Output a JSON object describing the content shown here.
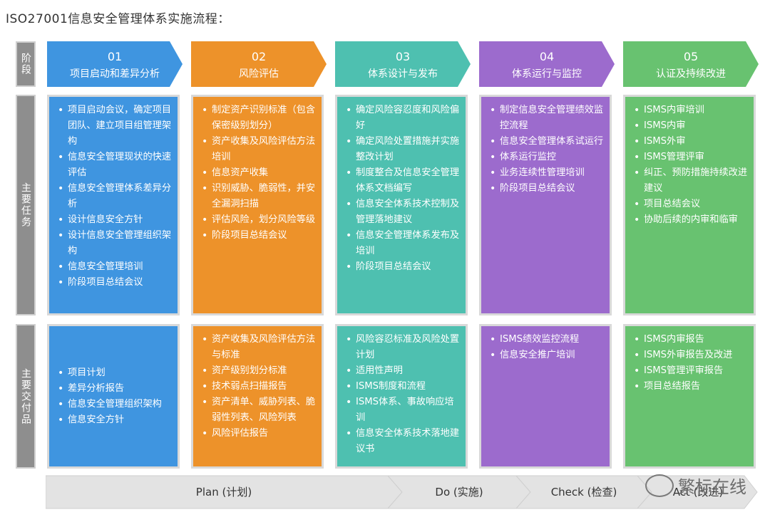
{
  "title": "ISO27001信息安全管理体系实施流程：",
  "row_labels": {
    "stage": "阶段",
    "tasks": "主要任务",
    "deliverables": "主要交付品"
  },
  "phases": [
    {
      "num": "01",
      "name": "项目启动和差异分析",
      "color": "#3f95e0",
      "tasks": [
        "项目启动会议，确定项目团队、建立项目组管理架构",
        "信息安全管理现状的快速评估",
        "信息安全管理体系差异分析",
        "设计信息安全方针",
        "设计信息安全管理组织架构",
        "信息安全管理培训",
        "阶段项目总结会议"
      ],
      "deliverables": [
        "项目计划",
        "差异分析报告",
        "信息安全管理组织架构",
        "信息安全方针"
      ]
    },
    {
      "num": "02",
      "name": "风险评估",
      "color": "#ed922a",
      "tasks": [
        "制定资产识别标准（包含保密级别划分）",
        "资产收集及风险评估方法培训",
        "信息资产收集",
        "识别威胁、脆弱性，并安全漏洞扫描",
        "评估风险，划分风险等级",
        "阶段项目总结会议"
      ],
      "deliverables": [
        "资产收集及风险评估方法与标准",
        "资产级别划分标准",
        "技术弱点扫描报告",
        "资产清单、威胁列表、脆弱性列表、风险列表",
        "风险评估报告"
      ]
    },
    {
      "num": "03",
      "name": "体系设计与发布",
      "color": "#4ec0b0",
      "tasks": [
        "确定风险容忍度和风险偏好",
        "确定风险处置措施并实施整改计划",
        "制度整合及信息安全管理体系文档编写",
        "信息安全体系技术控制及管理落地建议",
        "信息安全管理体系发布及培训",
        "阶段项目总结会议"
      ],
      "deliverables": [
        "风险容忍标准及风险处置计划",
        "适用性声明",
        "ISMS制度和流程",
        "ISMS体系、事故响应培训",
        "信息安全体系技术落地建议书"
      ]
    },
    {
      "num": "04",
      "name": "体系运行与监控",
      "color": "#9c6bcd",
      "tasks": [
        "制定信息安全管理绩效监控流程",
        "信息安全管理体系试运行",
        "体系运行监控",
        "业务连续性管理培训",
        "阶段项目总结会议"
      ],
      "deliverables": [
        "ISMS绩效监控流程",
        "信息安全推广培训"
      ]
    },
    {
      "num": "05",
      "name": "认证及持续改进",
      "color": "#68c270",
      "tasks": [
        "ISMS内审培训",
        "ISMS内审",
        "ISMS外审",
        "ISMS管理评审",
        "纠正、预防措施持续改进建议",
        "项目总结会议",
        "协助后续的内审和临审"
      ],
      "deliverables": [
        "ISMS内审报告",
        "ISMS外审报告及改进",
        "ISMS管理评审报告",
        "项目总结报告"
      ]
    }
  ],
  "pdca": [
    "Plan (计划)",
    "Do (实施)",
    "Check (检查)",
    "Act (改进)"
  ],
  "watermark": "繁标在线",
  "colors": {
    "arrow_bar": "#e3e3e3",
    "side_label": "#8e8e8e",
    "border": "#d9d9d9"
  }
}
